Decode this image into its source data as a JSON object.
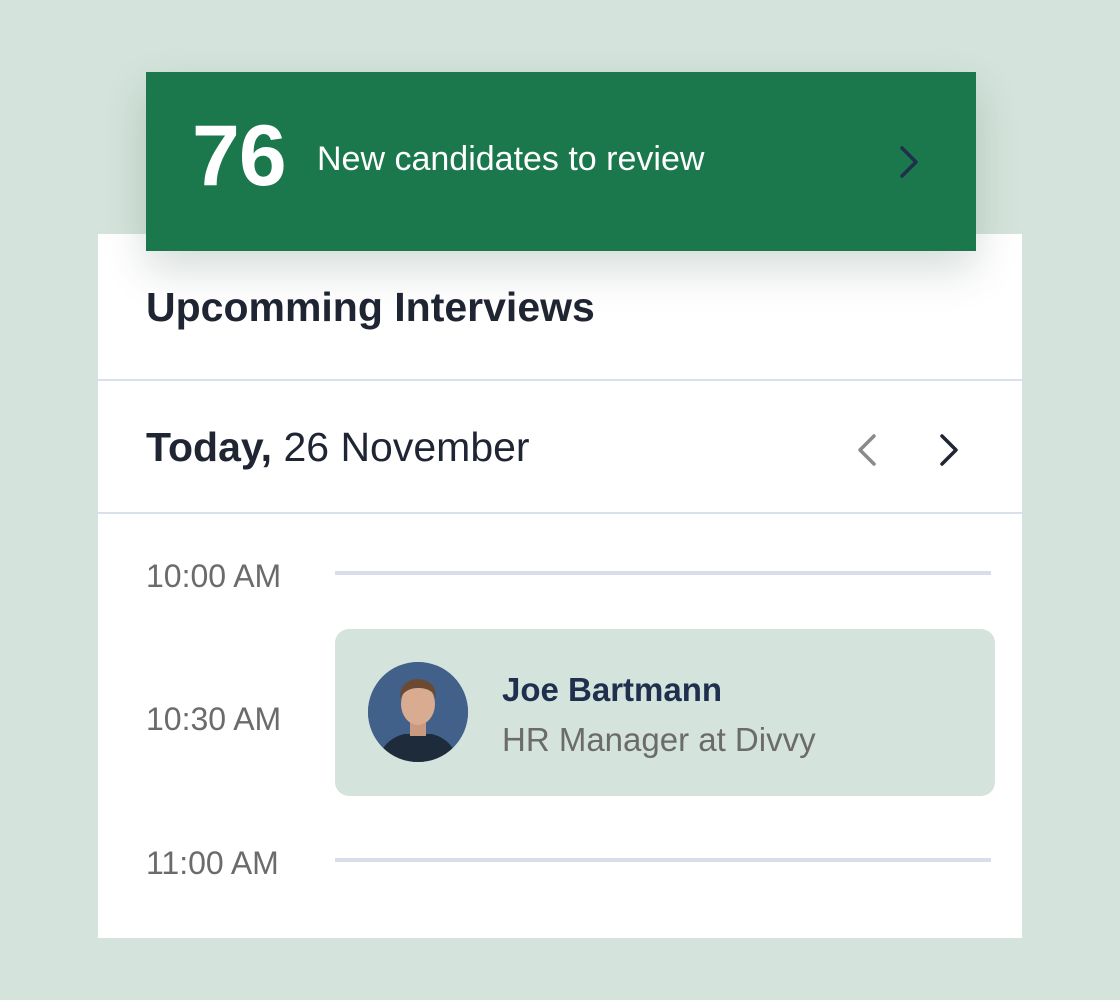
{
  "banner": {
    "count": "76",
    "text": "New candidates to review",
    "arrow_icon": "chevron-right-icon",
    "background": "#1b774c"
  },
  "interviews": {
    "title": "Upcomming Interviews",
    "date": {
      "prefix": "Today,",
      "value": "26 November"
    },
    "nav": {
      "prev_icon": "chevron-left-icon",
      "next_icon": "chevron-right-icon"
    },
    "time_slots": [
      {
        "label": "10:00 AM"
      },
      {
        "label": "10:30 AM"
      },
      {
        "label": "11:00 AM"
      }
    ],
    "appointment": {
      "name": "Joe Bartmann",
      "role": "HR Manager at Divvy",
      "avatar_icon": "avatar",
      "background": "#d4e4dc"
    }
  },
  "colors": {
    "page_background": "#d4e4dc",
    "accent_green": "#1b774c",
    "text_dark": "#1f2533",
    "text_muted": "#6b6b6b"
  }
}
